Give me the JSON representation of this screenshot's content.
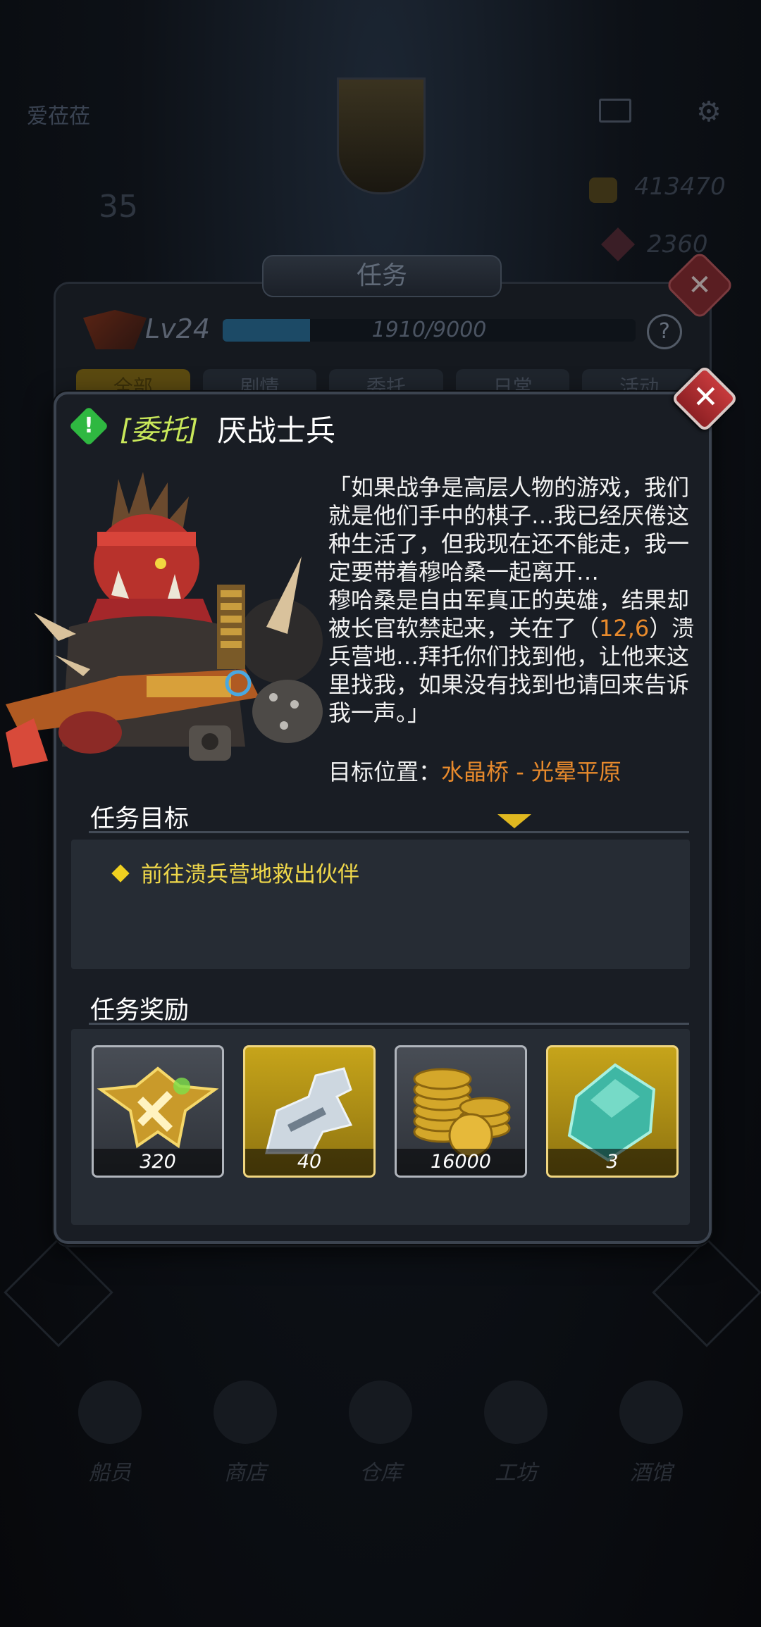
{
  "background": {
    "player_name": "爱莅莅",
    "level_display": "35",
    "coins": "413470",
    "gems": "2360",
    "panel_title": "任务",
    "panel_level": "Lv24",
    "exp_text": "1910/9000",
    "exp_progress": 0.212,
    "help_label": "?",
    "tabs": [
      {
        "label": "全部",
        "active": true
      },
      {
        "label": "剧情",
        "active": false
      },
      {
        "label": "委托",
        "active": false
      },
      {
        "label": "日常",
        "active": false
      },
      {
        "label": "活动",
        "active": false
      }
    ],
    "bottom_nav": [
      {
        "label": "船员"
      },
      {
        "label": "商店"
      },
      {
        "label": "仓库"
      },
      {
        "label": "工坊"
      },
      {
        "label": "酒馆"
      }
    ]
  },
  "dialog": {
    "close_label": "✕",
    "alert_label": "!",
    "quest_type": "[委托]",
    "quest_name": "厌战士兵",
    "description_part1": "「如果战争是高层人物的游戏，我们就是他们手中的棋子…我已经厌倦这种生活了，但我现在还不能走，我一定要带着穆哈桑一起离开…",
    "description_part2": "穆哈桑是自由军真正的英雄，结果却被长官软禁起来，关在了（",
    "description_coords": "12,6",
    "description_part3": "）溃兵营地…拜托你们找到他，让他来这里找我，如果没有找到也请回来告诉我一声。」",
    "target_label": "目标位置：",
    "target_location": "水晶桥 - 光晕平原",
    "objectives_title": "任务目标",
    "objectives": [
      {
        "text": "前往溃兵营地救出伙伴"
      }
    ],
    "rewards_title": "任务奖励",
    "rewards": [
      {
        "icon": "rank-badge-icon",
        "qty": "320",
        "frame": "silver"
      },
      {
        "icon": "weapon-part-icon",
        "qty": "40",
        "frame": "gold"
      },
      {
        "icon": "gold-coins-icon",
        "qty": "16000",
        "frame": "silver"
      },
      {
        "icon": "crystal-icon",
        "qty": "3",
        "frame": "gold"
      }
    ]
  },
  "colors": {
    "highlight": "#e88a2c",
    "quest_type": "#c9e85a",
    "objective": "#f0d84a",
    "alert": "#2fb841",
    "close": "#c63a3c"
  }
}
